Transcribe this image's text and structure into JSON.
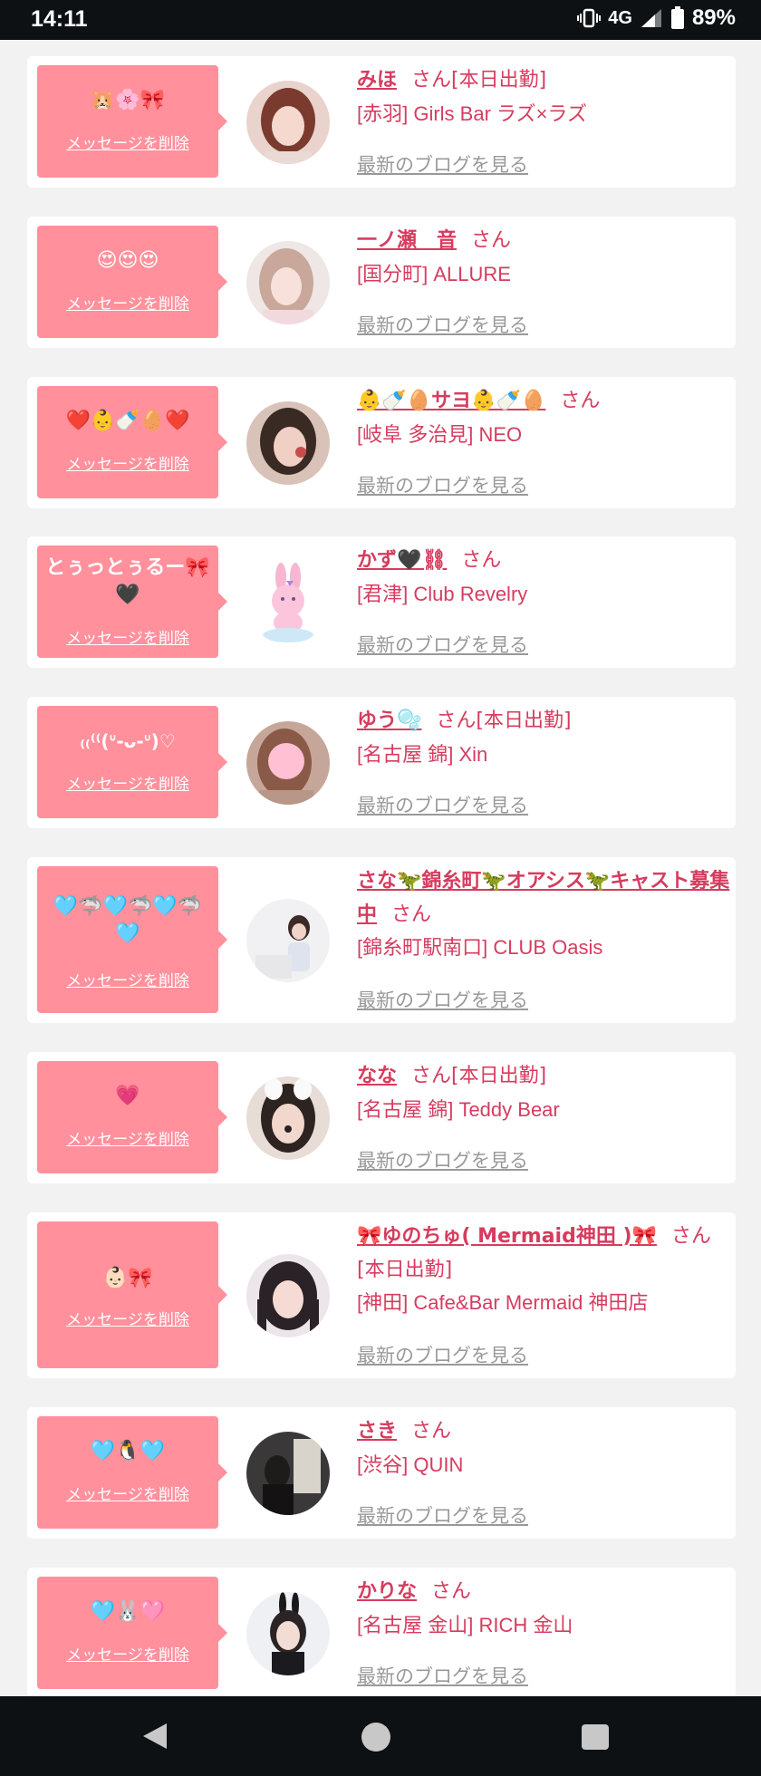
{
  "status": {
    "time": "14:11",
    "network": "4G",
    "battery": "89%"
  },
  "common": {
    "delete_label": "メッセージを削除",
    "blog_label": "最新のブログを見る",
    "san": "さん"
  },
  "cards": [
    {
      "emoji": "🐹🌸🎀",
      "name": "みほ",
      "tag": "[本日出勤]",
      "shop": "[赤羽] Girls Bar ラズ×ラズ"
    },
    {
      "emoji": "😍😍😍",
      "name": "一ノ瀬　音",
      "tag": "",
      "shop": "[国分町] ALLURE"
    },
    {
      "emoji": "❤️👶🍼🥚❤️",
      "name": "👶🍼🥚サヨ👶🍼🥚",
      "tag": "",
      "shop": "[岐阜 多治見] NEO"
    },
    {
      "emoji": "とぅっとぅるー🎀🖤",
      "name": "かず🖤⛓",
      "tag": "",
      "shop": "[君津] Club Revelry"
    },
    {
      "emoji": "₍₍⁽⁽(ᐡ-ᴗ-ᐡ)♡",
      "name": "ゆう🫧",
      "tag": "[本日出勤]",
      "shop": "[名古屋 錦] Xin"
    },
    {
      "emoji": "🩵🦈🩵🦈🩵🦈🩵",
      "name": "さな🦖錦糸町🦖オアシス🦖キャスト募集中",
      "tag": "",
      "shop": "[錦糸町駅南口] CLUB Oasis"
    },
    {
      "emoji": "💗",
      "name": "なな",
      "tag": "[本日出勤]",
      "shop": "[名古屋 錦] Teddy Bear"
    },
    {
      "emoji": "👶🏻🎀",
      "name": "🎀ゆのちゅ( Mermaid神田 )🎀",
      "tag": "[本日出勤]",
      "shop": "[神田] Cafe&Bar Mermaid 神田店"
    },
    {
      "emoji": "🩵🐧🩵",
      "name": "さき",
      "tag": "",
      "shop": "[渋谷] QUIN"
    },
    {
      "emoji": "🩵🐰🩷",
      "name": "かりな",
      "tag": "",
      "shop": "[名古屋 金山] RICH 金山"
    }
  ],
  "nav": {
    "back": "back-icon",
    "home": "home-icon",
    "recent": "recent-apps-icon"
  }
}
